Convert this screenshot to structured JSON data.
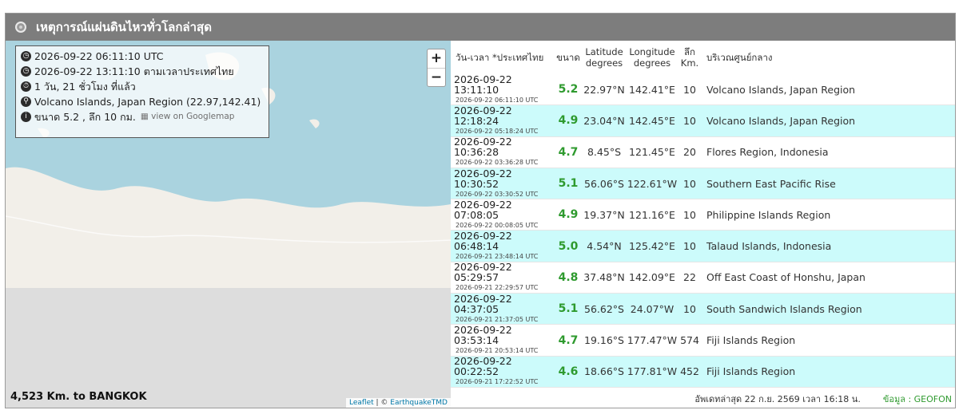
{
  "header": {
    "title": "เหตุการณ์แผ่นดินไหวทั่วโลกล่าสุด"
  },
  "map": {
    "zoom_in": "+",
    "zoom_out": "−",
    "info": {
      "utc_time": "2026-09-22 06:11:10 UTC",
      "local_time": "2026-09-22 13:11:10 ตามเวลาประเทศไทย",
      "ago": "1 วัน, 21 ชั่วโมง ที่แล้ว",
      "location": "Volcano Islands, Japan Region (22.97,142.41)",
      "magnitude_depth": "ขนาด 5.2 , ลึก 10 กม.",
      "googlemap_link": "view on Googlemap"
    },
    "distance": "4,523 Km. to BANGKOK",
    "attribution_leaflet": "Leaflet",
    "attribution_sep": " | © ",
    "attribution_source": "EarthquakeTMD"
  },
  "table": {
    "headers": {
      "time": "วัน-เวลา *ประเทศไทย",
      "magnitude": "ขนาด",
      "lat_1": "Latitude",
      "lat_2": "degrees",
      "lon_1": "Longitude",
      "lon_2": "degrees",
      "depth_1": "ลึก",
      "depth_2": "Km.",
      "region": "บริเวณศูนย์กลาง"
    },
    "rows": [
      {
        "local": "2026-09-22 13:11:10",
        "utc": "2026-09-22 06:11:10 UTC",
        "mag": "5.2",
        "lat": "22.97°N",
        "lon": "142.41°E",
        "depth": "10",
        "region": "Volcano Islands, Japan Region"
      },
      {
        "local": "2026-09-22 12:18:24",
        "utc": "2026-09-22 05:18:24 UTC",
        "mag": "4.9",
        "lat": "23.04°N",
        "lon": "142.45°E",
        "depth": "10",
        "region": "Volcano Islands, Japan Region"
      },
      {
        "local": "2026-09-22 10:36:28",
        "utc": "2026-09-22 03:36:28 UTC",
        "mag": "4.7",
        "lat": "8.45°S",
        "lon": "121.45°E",
        "depth": "20",
        "region": "Flores Region, Indonesia"
      },
      {
        "local": "2026-09-22 10:30:52",
        "utc": "2026-09-22 03:30:52 UTC",
        "mag": "5.1",
        "lat": "56.06°S",
        "lon": "122.61°W",
        "depth": "10",
        "region": "Southern East Pacific Rise"
      },
      {
        "local": "2026-09-22 07:08:05",
        "utc": "2026-09-22 00:08:05 UTC",
        "mag": "4.9",
        "lat": "19.37°N",
        "lon": "121.16°E",
        "depth": "10",
        "region": "Philippine Islands Region"
      },
      {
        "local": "2026-09-22 06:48:14",
        "utc": "2026-09-21 23:48:14 UTC",
        "mag": "5.0",
        "lat": "4.54°N",
        "lon": "125.42°E",
        "depth": "10",
        "region": "Talaud Islands, Indonesia"
      },
      {
        "local": "2026-09-22 05:29:57",
        "utc": "2026-09-21 22:29:57 UTC",
        "mag": "4.8",
        "lat": "37.48°N",
        "lon": "142.09°E",
        "depth": "22",
        "region": "Off East Coast of Honshu, Japan"
      },
      {
        "local": "2026-09-22 04:37:05",
        "utc": "2026-09-21 21:37:05 UTC",
        "mag": "5.1",
        "lat": "56.62°S",
        "lon": "24.07°W",
        "depth": "10",
        "region": "South Sandwich Islands Region"
      },
      {
        "local": "2026-09-22 03:53:14",
        "utc": "2026-09-21 20:53:14 UTC",
        "mag": "4.7",
        "lat": "19.16°S",
        "lon": "177.47°W",
        "depth": "574",
        "region": "Fiji Islands Region"
      },
      {
        "local": "2026-09-22 00:22:52",
        "utc": "2026-09-21 17:22:52 UTC",
        "mag": "4.6",
        "lat": "18.66°S",
        "lon": "177.81°W",
        "depth": "452",
        "region": "Fiji Islands Region"
      }
    ]
  },
  "footer": {
    "updated": "อัพเดทล่าสุด 22 ก.ย. 2569 เวลา 16:18 น.",
    "source": "ข้อมูล : GEOFON"
  },
  "colors": {
    "magnitude": "#2e9a2e",
    "row_alt": "#ccfbfb",
    "header_bg": "#7d7d7d",
    "ocean": "#aad3df"
  }
}
